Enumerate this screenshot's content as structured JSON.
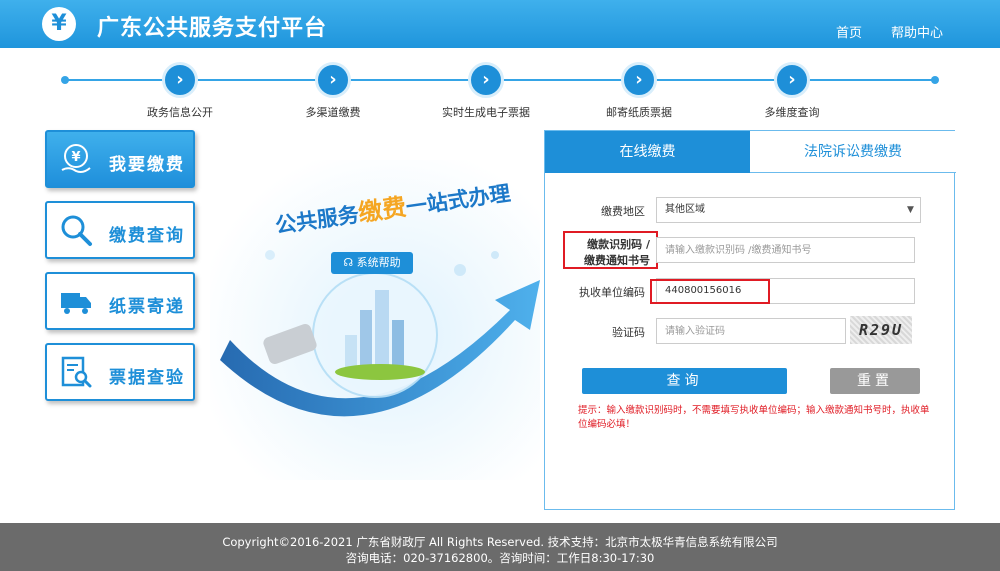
{
  "header": {
    "logo_glyph": "¥",
    "title": "广东公共服务支付平台",
    "nav": [
      "首页",
      "帮助中心"
    ]
  },
  "steps": [
    {
      "label": "政务信息公开",
      "icon": "chevron-right-icon"
    },
    {
      "label": "多渠道缴费",
      "icon": "chevron-right-icon"
    },
    {
      "label": "实时生成电子票据",
      "icon": "chevron-right-icon"
    },
    {
      "label": "邮寄纸质票据",
      "icon": "chevron-right-icon"
    },
    {
      "label": "多维度查询",
      "icon": "chevron-right-icon"
    }
  ],
  "menu": [
    {
      "label": "我要缴费",
      "icon": "yen-hand-icon",
      "active": true
    },
    {
      "label": "缴费查询",
      "icon": "search-icon",
      "active": false
    },
    {
      "label": "纸票寄递",
      "icon": "delivery-truck-icon",
      "active": false
    },
    {
      "label": "票据查验",
      "icon": "document-search-icon",
      "active": false
    }
  ],
  "banner": {
    "slogan_pre": "公共服务",
    "slogan_highlight": "缴费",
    "slogan_post": "一站式办理",
    "help_button": "系统帮助"
  },
  "form": {
    "tabs": [
      "在线缴费",
      "法院诉讼费缴费"
    ],
    "region_label": "缴费地区",
    "region_value": "其他区域",
    "payment_code_label_1": "缴款识别码 /",
    "payment_code_label_2": "缴费通知书号",
    "payment_code_placeholder": "请输入缴款识别码 /缴费通知书号",
    "unit_code_label": "执收单位编码",
    "unit_code_value": "440800156016",
    "captcha_label": "验证码",
    "captcha_placeholder": "请输入验证码",
    "captcha_text": "R29U",
    "query_button": "查询",
    "reset_button": "重置",
    "hint": "提示：输入缴款识别码时，不需要填写执收单位编码；输入缴款通知书号时，执收单位编码必填！"
  },
  "footer": {
    "line1": "Copyright©2016-2021 广东省财政厅 All Rights Reserved. 技术支持：北京市太极华青信息系统有限公司",
    "line2": "咨询电话：020-37162800。咨询时间：工作日8:30-17:30"
  },
  "colors": {
    "primary": "#1e8fd8",
    "accent_yellow": "#f5a623",
    "warning_red": "#e01b24",
    "footer_gray": "#6b6b6b"
  }
}
